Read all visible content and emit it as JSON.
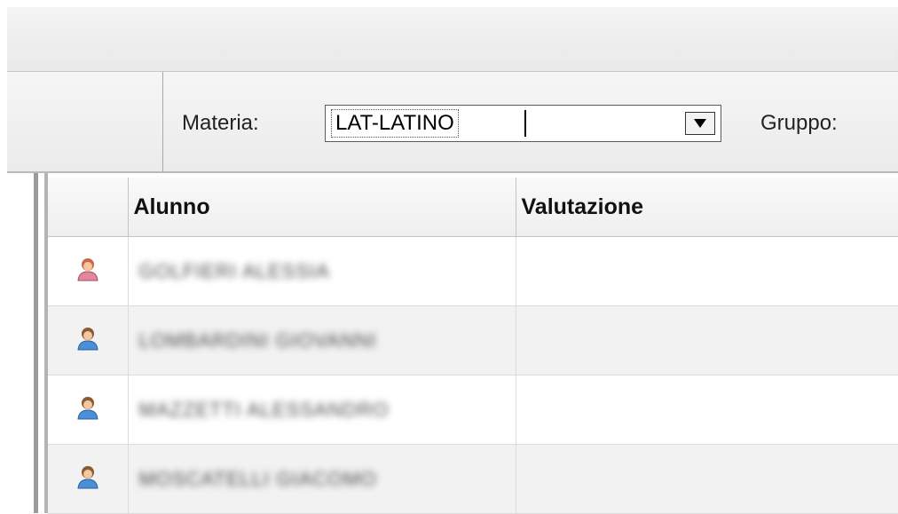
{
  "toolbar": {
    "materia_label": "Materia:",
    "materia_value": "LAT-LATINO",
    "gruppo_label": "Gruppo:"
  },
  "grid": {
    "columns": [
      "",
      "Alunno",
      "Valutazione"
    ],
    "rows": [
      {
        "icon": "female-student-icon",
        "icon_color": "#e3869e",
        "name": "GOLFIERI ALESSIA",
        "valutazione": ""
      },
      {
        "icon": "male-student-icon",
        "icon_color": "#4a8fd8",
        "name": "LOMBARDINI GIOVANNI",
        "valutazione": ""
      },
      {
        "icon": "male-student-icon",
        "icon_color": "#4a8fd8",
        "name": "MAZZETTI ALESSANDRO",
        "valutazione": ""
      },
      {
        "icon": "male-student-icon",
        "icon_color": "#4a8fd8",
        "name": "MOSCATELLI GIACOMO",
        "valutazione": ""
      }
    ]
  },
  "colors": {
    "female_icon": "#e3869e",
    "male_icon": "#4a8fd8",
    "row_alt_bg": "#f2f2f2"
  }
}
